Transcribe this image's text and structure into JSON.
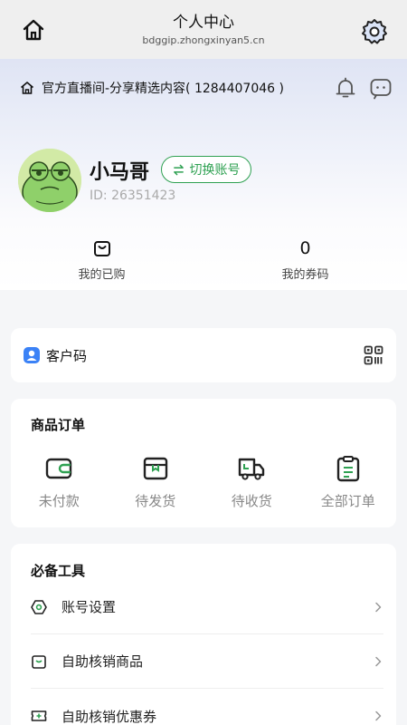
{
  "header": {
    "title": "个人中心",
    "url": "bdggip.zhongxinyan5.cn"
  },
  "notice": {
    "text": "官方直播间-分享精选内容( 1284407046 )"
  },
  "profile": {
    "name": "小马哥",
    "switch_label": "切换账号",
    "id_text": "ID: 26351423"
  },
  "stats": [
    {
      "value": "",
      "label": "我的已购"
    },
    {
      "value": "0",
      "label": "我的券码"
    }
  ],
  "customer_code": {
    "label": "客户码"
  },
  "orders": {
    "title": "商品订单",
    "items": [
      {
        "label": "未付款",
        "icon": "wallet-icon"
      },
      {
        "label": "待发货",
        "icon": "box-icon"
      },
      {
        "label": "待收货",
        "icon": "truck-icon"
      },
      {
        "label": "全部订单",
        "icon": "clipboard-icon"
      }
    ]
  },
  "tools": {
    "title": "必备工具",
    "items": [
      {
        "label": "账号设置",
        "icon": "hexagon-icon"
      },
      {
        "label": "自助核销商品",
        "icon": "bag-icon"
      },
      {
        "label": "自助核销优惠券",
        "icon": "ticket-icon"
      }
    ]
  },
  "colors": {
    "accent": "#2fa152",
    "text": "#222222",
    "muted": "#888888"
  }
}
